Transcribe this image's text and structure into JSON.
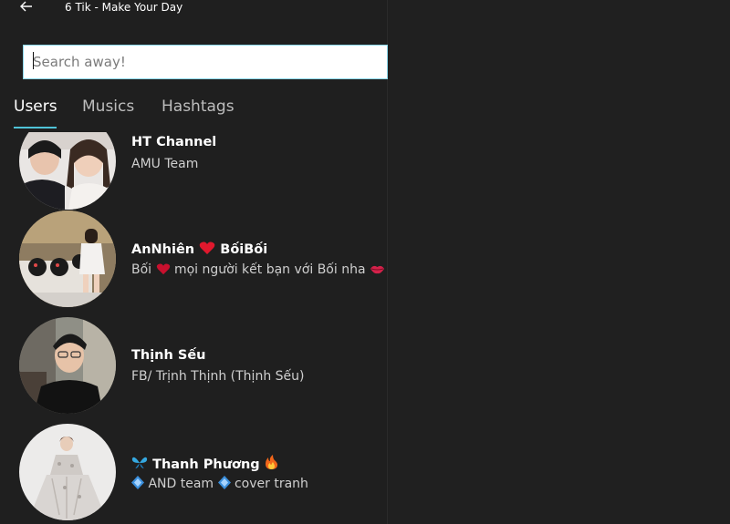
{
  "window": {
    "title": "6 Tik - Make Your Day"
  },
  "search": {
    "placeholder": "Search away!"
  },
  "tabs": [
    {
      "label": "Users",
      "active": true
    },
    {
      "label": "Musics",
      "active": false
    },
    {
      "label": "Hashtags",
      "active": false
    }
  ],
  "users": [
    {
      "name": "HT Channel",
      "bio": "AMU Team"
    },
    {
      "name_a": "AnNhiên",
      "name_b": "BốiBối",
      "name_emoji": "heart-icon",
      "bio_a": "Bối",
      "bio_b": "mọi người kết bạn với Bối nha",
      "bio_emoji_a": "heart-icon",
      "bio_emoji_b": "kiss-lips-icon"
    },
    {
      "name": "Thịnh Sếu",
      "bio": "FB/ Trịnh Thịnh (Thịnh Sếu)"
    },
    {
      "name": "Thanh Phương",
      "name_emoji_a": "butterfly-icon",
      "name_emoji_b": "fire-icon",
      "bio_a": "AND team",
      "bio_b": "cover tranh",
      "bio_emoji": "blue-diamond-icon"
    }
  ],
  "colors": {
    "background": "#1f1f1f",
    "accent": "#4fc3d8",
    "search_bg": "#ffffff",
    "text_secondary": "#cfcfcf"
  }
}
